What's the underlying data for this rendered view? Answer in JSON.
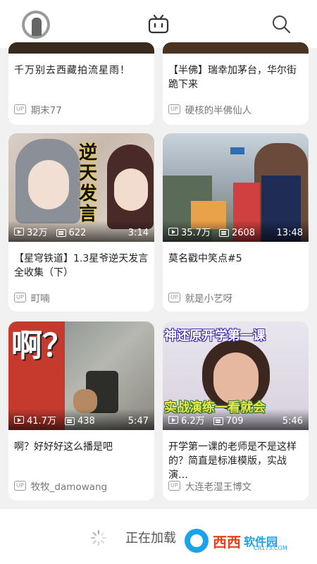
{
  "header": {
    "avatar": "avatar",
    "tv_icon": "tv-icon",
    "search_icon": "search-icon"
  },
  "top_row": [
    {
      "title": "千万别去西藏拍流星雨！",
      "uploader": "期末77"
    },
    {
      "title": "【半佛】瑞幸加茅台，华尔街跪下来",
      "uploader": "硬核的半佛仙人"
    }
  ],
  "videos": [
    {
      "plays": "32万",
      "danmaku": "622",
      "duration": "3:14",
      "title": "【星穹铁道】1.3星爷逆天发言全收集（下）",
      "uploader": "町喃",
      "thumb_caption": "逆天发言"
    },
    {
      "plays": "35.7万",
      "danmaku": "2608",
      "duration": "13:48",
      "title": "莫名戳中笑点#5",
      "uploader": "就是小艺呀"
    },
    {
      "plays": "41.7万",
      "danmaku": "438",
      "duration": "5:47",
      "title": "啊？好好好这么播是吧",
      "uploader": "牧牧_damowang",
      "thumb_caption": "啊？"
    },
    {
      "plays": "6.2万",
      "danmaku": "709",
      "duration": "5:46",
      "title": "开学第一课的老师是不是这样的？简直是标准模版，实战演…",
      "uploader": "大连老湿王博文",
      "thumb_caption_top": "神还原开学第一课",
      "thumb_caption_bottom": "实战演练一看就会"
    }
  ],
  "up_badge": "UP",
  "footer": {
    "loading_text": "正在加载",
    "watermark_text1": "西西",
    "watermark_text2": "软件园",
    "watermark_sub": "CR173.COM"
  }
}
